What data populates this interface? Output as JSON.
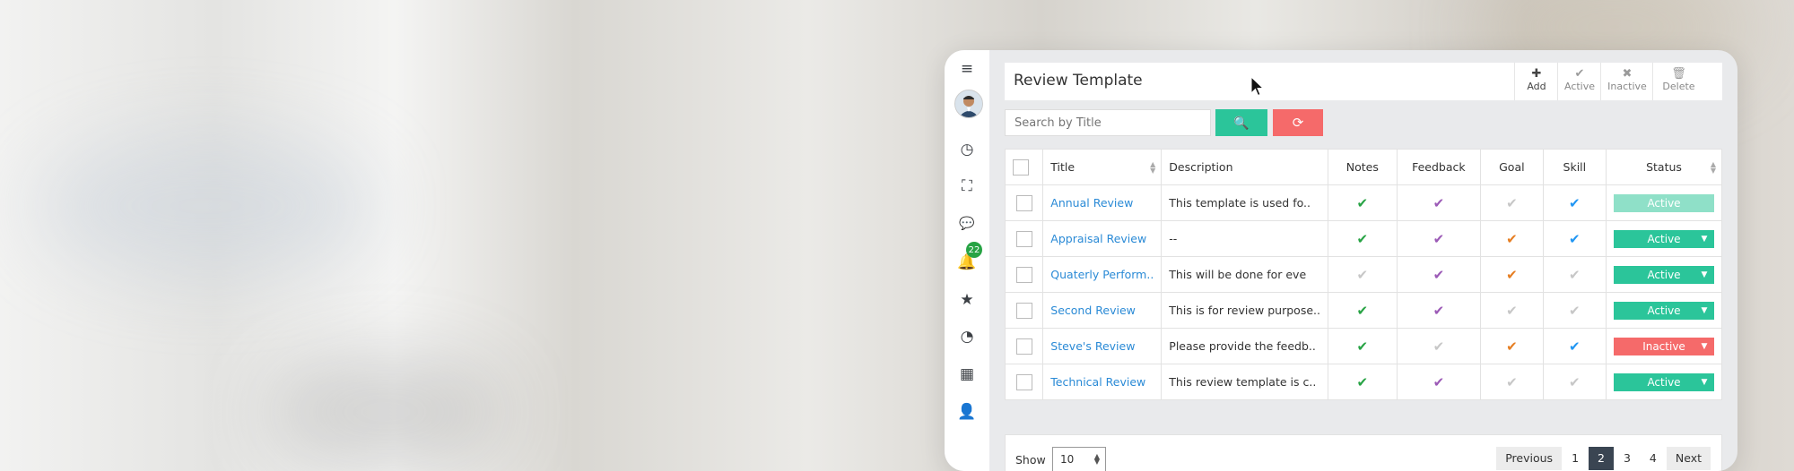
{
  "header": {
    "title": "Review Template",
    "tools": [
      {
        "label": "Add",
        "icon": "plus-icon"
      },
      {
        "label": "Active",
        "icon": "check-icon"
      },
      {
        "label": "Inactive",
        "icon": "times-icon"
      },
      {
        "label": "Delete",
        "icon": "trash-icon"
      }
    ]
  },
  "search": {
    "placeholder": "Search by Title"
  },
  "sidebar": {
    "notification_count": "22"
  },
  "table": {
    "columns": [
      "Title",
      "Description",
      "Notes",
      "Feedback",
      "Goal",
      "Skill",
      "Status"
    ],
    "rows": [
      {
        "title": "Annual Review",
        "description": "This template is used fo..",
        "status": "Active"
      },
      {
        "title": "Appraisal Review",
        "description": "--",
        "status": "Active"
      },
      {
        "title": "Quaterly Perform..",
        "description": "This will be done for eve",
        "status": "Active"
      },
      {
        "title": "Second Review",
        "description": "This is for review purpose..",
        "status": "Active"
      },
      {
        "title": "Steve's Review",
        "description": "Please provide the feedb..",
        "status": "Inactive"
      },
      {
        "title": "Technical Review",
        "description": "This review template is c..",
        "status": "Active"
      }
    ]
  },
  "footer": {
    "show_label": "Show",
    "page_size": "10",
    "pagination": [
      "Previous",
      "1",
      "2",
      "3",
      "4",
      "Next"
    ]
  },
  "colors": {
    "active": "#2bc59a",
    "inactive": "#f56a6a",
    "link": "#2a8ad6",
    "check_green": "#27a344",
    "check_purple": "#9b59b6",
    "check_orange": "#e67e22",
    "check_blue": "#2196f3",
    "check_grey": "#c7c7c7"
  }
}
